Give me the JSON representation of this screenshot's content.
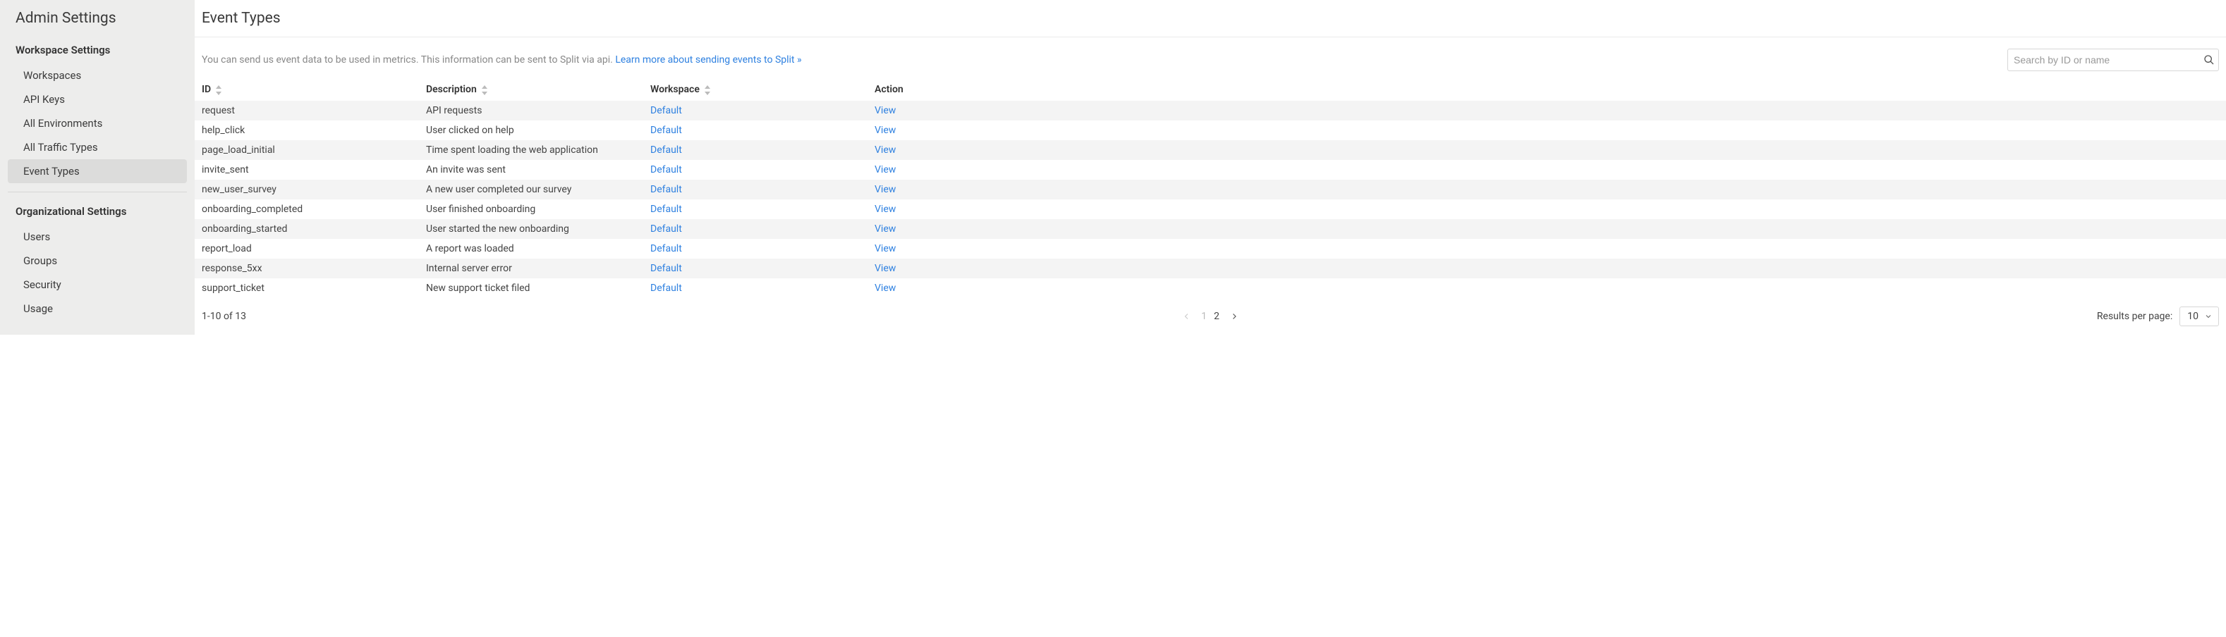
{
  "sidebar": {
    "title": "Admin Settings",
    "sections": [
      {
        "label": "Workspace Settings",
        "items": [
          {
            "label": "Workspaces",
            "name": "sidebar-item-workspaces"
          },
          {
            "label": "API Keys",
            "name": "sidebar-item-api-keys"
          },
          {
            "label": "All Environments",
            "name": "sidebar-item-all-environments"
          },
          {
            "label": "All Traffic Types",
            "name": "sidebar-item-all-traffic-types"
          },
          {
            "label": "Event Types",
            "name": "sidebar-item-event-types",
            "active": true
          }
        ]
      },
      {
        "label": "Organizational Settings",
        "items": [
          {
            "label": "Users",
            "name": "sidebar-item-users"
          },
          {
            "label": "Groups",
            "name": "sidebar-item-groups"
          },
          {
            "label": "Security",
            "name": "sidebar-item-security"
          },
          {
            "label": "Usage",
            "name": "sidebar-item-usage"
          }
        ]
      }
    ]
  },
  "main": {
    "title": "Event Types",
    "intro_text": "You can send us event data to be used in metrics. This information can be sent to Split via api. ",
    "intro_link": "Learn more about sending events to Split »",
    "search_placeholder": "Search by ID or name",
    "columns": {
      "id": "ID",
      "description": "Description",
      "workspace": "Workspace",
      "action": "Action"
    },
    "action_label": "View",
    "rows": [
      {
        "id": "request",
        "description": "API requests",
        "workspace": "Default"
      },
      {
        "id": "help_click",
        "description": "User clicked on help",
        "workspace": "Default"
      },
      {
        "id": "page_load_initial",
        "description": "Time spent loading the web application",
        "workspace": "Default"
      },
      {
        "id": "invite_sent",
        "description": "An invite was sent",
        "workspace": "Default"
      },
      {
        "id": "new_user_survey",
        "description": "A new user completed our survey",
        "workspace": "Default"
      },
      {
        "id": "onboarding_completed",
        "description": "User finished onboarding",
        "workspace": "Default"
      },
      {
        "id": "onboarding_started",
        "description": "User started the new onboarding",
        "workspace": "Default"
      },
      {
        "id": "report_load",
        "description": "A report was loaded",
        "workspace": "Default"
      },
      {
        "id": "response_5xx",
        "description": "Internal server error",
        "workspace": "Default"
      },
      {
        "id": "support_ticket",
        "description": "New support ticket filed",
        "workspace": "Default"
      }
    ],
    "pager": {
      "range": "1-10 of 13",
      "pages": [
        "1",
        "2"
      ],
      "current": "1",
      "rpp_label": "Results per page:",
      "rpp_value": "10"
    }
  }
}
